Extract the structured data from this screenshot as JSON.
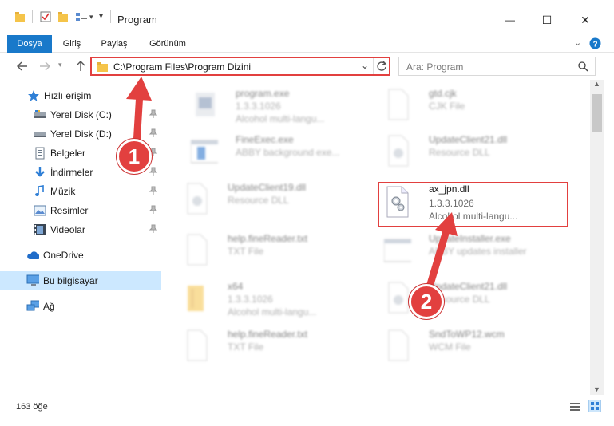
{
  "window": {
    "title": "Program",
    "controls": {
      "minimize": "—",
      "maximize": "☐",
      "close": "✕"
    }
  },
  "ribbon": {
    "tabs": [
      {
        "label": "Dosya",
        "active": true
      },
      {
        "label": "Giriş"
      },
      {
        "label": "Paylaş"
      },
      {
        "label": "Görünüm"
      }
    ]
  },
  "address": {
    "path": "C:\\Program Files\\Program Dizini",
    "search_placeholder": "Ara: Program"
  },
  "nav": {
    "items": [
      {
        "label": "Hızlı erişim",
        "icon": "star-icon"
      },
      {
        "label": "Yerel Disk (C:)",
        "icon": "drive-icon",
        "pinned": true
      },
      {
        "label": "Yerel Disk (D:)",
        "icon": "drive-icon",
        "pinned": true
      },
      {
        "label": "Belgeler",
        "icon": "documents-icon",
        "pinned": true
      },
      {
        "label": "İndirmeler",
        "icon": "download-icon",
        "pinned": true
      },
      {
        "label": "Müzik",
        "icon": "music-icon",
        "pinned": true
      },
      {
        "label": "Resimler",
        "icon": "pictures-icon",
        "pinned": true
      },
      {
        "label": "Videolar",
        "icon": "videos-icon",
        "pinned": true
      },
      {
        "label": "OneDrive",
        "icon": "cloud-icon"
      },
      {
        "label": "Bu bilgisayar",
        "icon": "computer-icon",
        "selected": true
      },
      {
        "label": "Ağ",
        "icon": "network-icon"
      }
    ]
  },
  "files": [
    {
      "name": "program.exe",
      "line2": "1.3.3.1026",
      "line3": "Alcohol multi-langu...",
      "icon": "exe-icon",
      "blurred": true
    },
    {
      "name": "gtd.cjk",
      "line2": "CJK File",
      "line3": "",
      "icon": "file-icon",
      "blurred": true
    },
    {
      "name": "FineExec.exe",
      "line2": "ABBY background exe...",
      "line3": "",
      "icon": "app-window-icon",
      "blurred": true
    },
    {
      "name": "UpdateClient21.dll",
      "line2": "Resource DLL",
      "line3": "",
      "icon": "dll-icon",
      "blurred": true
    },
    {
      "name": "UpdateClient19.dll",
      "line2": "Resource DLL",
      "line3": "",
      "icon": "dll-icon",
      "blurred": true
    },
    {
      "name": "ax_jpn.dll",
      "line2": "1.3.3.1026",
      "line3": "Alcohol multi-langu...",
      "icon": "dll-icon",
      "blurred": false
    },
    {
      "name": "help.fineReader.txt",
      "line2": "TXT File",
      "line3": "",
      "icon": "file-icon",
      "blurred": true
    },
    {
      "name": "UpdateInstaller.exe",
      "line2": "ABBY updates installer",
      "line3": "",
      "icon": "app-window-icon",
      "blurred": true
    },
    {
      "name": "x64",
      "line2": "1.3.3.1026",
      "line3": "Alcohol multi-langu...",
      "icon": "folder-icon",
      "blurred": true
    },
    {
      "name": "UpdateClient21.dll",
      "line2": "Resource DLL",
      "line3": "",
      "icon": "dll-icon",
      "blurred": true
    },
    {
      "name": "help.fineReader.txt",
      "line2": "TXT File",
      "line3": "",
      "icon": "file-icon",
      "blurred": true
    },
    {
      "name": "SndToWP12.wcm",
      "line2": "WCM File",
      "line3": "",
      "icon": "file-icon",
      "blurred": true
    }
  ],
  "status": {
    "item_count": "163 öğe"
  },
  "annotations": {
    "step1": "1",
    "step2": "2",
    "accent": "#e2403f"
  }
}
